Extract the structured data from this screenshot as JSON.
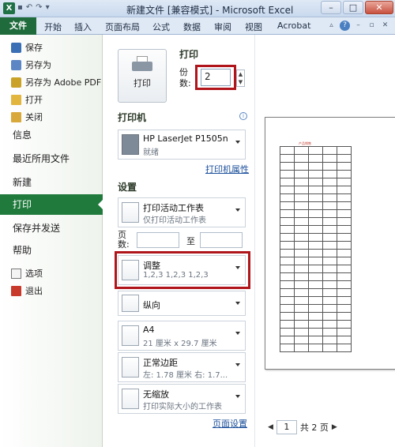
{
  "window": {
    "title": "新建文件 [兼容模式] - Microsoft Excel",
    "app_icon": "X"
  },
  "ribbon": {
    "tabs": [
      "文件",
      "开始",
      "插入",
      "页面布局",
      "公式",
      "数据",
      "审阅",
      "视图",
      "Acrobat"
    ]
  },
  "sidebar": {
    "commands": [
      {
        "label": "保存",
        "icon": "save-icon"
      },
      {
        "label": "另存为",
        "icon": "save-as-icon"
      },
      {
        "label": "另存为 Adobe PDF",
        "icon": "pdf-icon"
      },
      {
        "label": "打开",
        "icon": "open-folder-icon"
      },
      {
        "label": "关闭",
        "icon": "close-folder-icon"
      }
    ],
    "tabs": [
      "信息",
      "最近所用文件",
      "新建",
      "打印",
      "保存并发送",
      "帮助"
    ],
    "active_tab": "打印",
    "bottom_commands": [
      {
        "label": "选项",
        "icon": "options-icon"
      },
      {
        "label": "退出",
        "icon": "exit-icon"
      }
    ]
  },
  "print": {
    "heading": "打印",
    "button_label": "打印",
    "copies_label": "份数:",
    "copies_value": "2",
    "printer_heading": "打印机",
    "printer_name": "HP LaserJet P1505n",
    "printer_status": "就绪",
    "printer_properties_link": "打印机属性",
    "settings_heading": "设置",
    "scope_title": "打印活动工作表",
    "scope_sub": "仅打印活动工作表",
    "pages_label": "页数:",
    "pages_to": "至",
    "collate_title": "调整",
    "collate_sub": "1,2,3    1,2,3    1,2,3",
    "orientation": "纵向",
    "paper_title": "A4",
    "paper_sub": "21 厘米 x 29.7 厘米",
    "margins_title": "正常边距",
    "margins_sub": "左: 1.78 厘米   右: 1.7...",
    "scaling_title": "无缩放",
    "scaling_sub": "打印实际大小的工作表",
    "page_setup_link": "页面设置"
  },
  "preview": {
    "page_title": "产品销售",
    "current_page": "1",
    "total_pages_label": "共 2 页"
  },
  "colors": {
    "file_tab": "#1f6b3c",
    "active_sidebar": "#1f7a3c",
    "highlight": "#b0151b"
  }
}
